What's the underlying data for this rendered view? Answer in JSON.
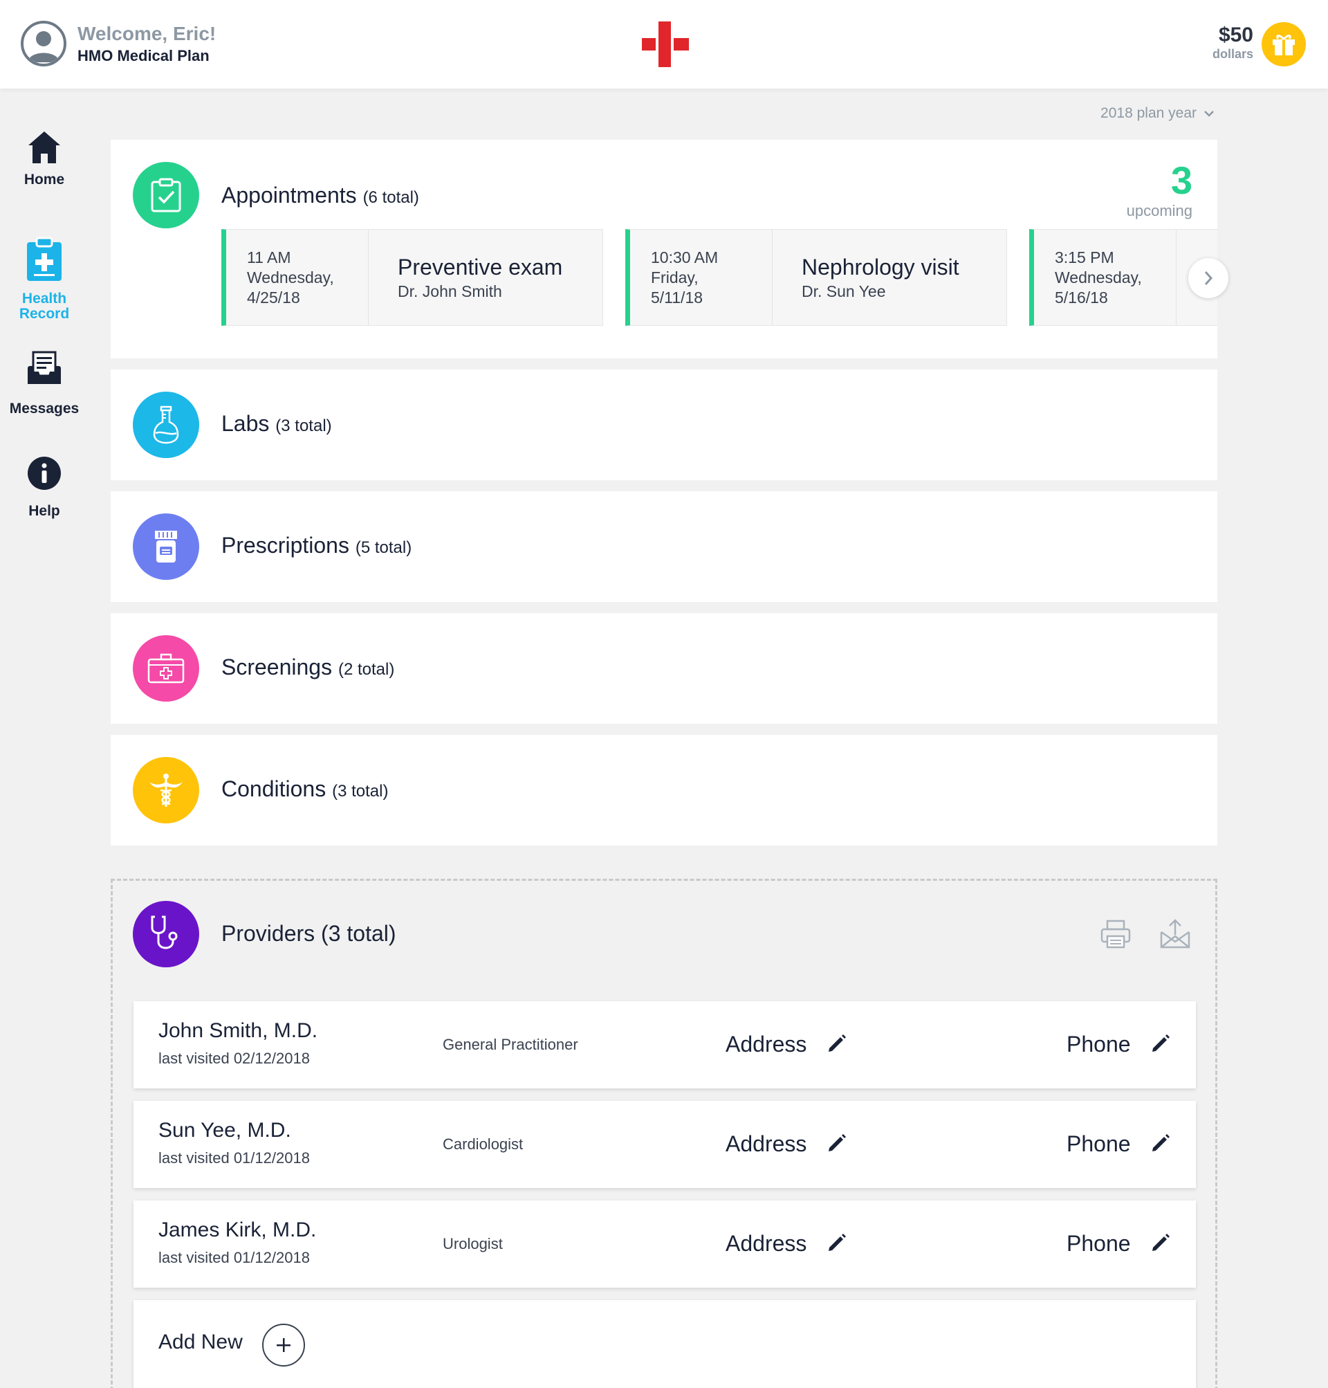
{
  "header": {
    "welcome": "Welcome, Eric!",
    "plan": "HMO Medical Plan",
    "credits_amount": "$50",
    "credits_unit": "dollars"
  },
  "sidebar": {
    "items": [
      {
        "label": "Home",
        "icon": "home-icon"
      },
      {
        "label_line1": "Health",
        "label_line2": "Record",
        "icon": "health-record-icon",
        "active": true
      },
      {
        "label": "Messages",
        "icon": "messages-icon"
      },
      {
        "label": "Help",
        "icon": "info-icon"
      }
    ]
  },
  "plan_year": "2018 plan year",
  "appointments": {
    "title": "Appointments",
    "total": "(6 total)",
    "upcoming_count": "3",
    "upcoming_label": "upcoming",
    "items": [
      {
        "time": "11 AM",
        "day": "Wednesday,",
        "date": "4/25/18",
        "name": "Preventive exam",
        "doctor": "Dr. John Smith"
      },
      {
        "time": "10:30 AM",
        "day": "Friday,",
        "date": "5/11/18",
        "name": "Nephrology visit",
        "doctor": "Dr. Sun Yee"
      },
      {
        "time": "3:15 PM",
        "day": "Wednesday,",
        "date": "5/16/18",
        "name": "",
        "doctor": ""
      }
    ]
  },
  "sections": [
    {
      "title": "Labs",
      "total": "(3 total)",
      "color": "#1cb8e8",
      "icon": "flask-icon"
    },
    {
      "title": "Prescriptions",
      "total": "(5 total)",
      "color": "#6d7ff0",
      "icon": "pill-bottle-icon"
    },
    {
      "title": "Screenings",
      "total": "(2 total)",
      "color": "#f54aa7",
      "icon": "medical-kit-icon"
    },
    {
      "title": "Conditions",
      "total": "(3 total)",
      "color": "#ffc30a",
      "icon": "caduceus-icon"
    }
  ],
  "providers": {
    "title": "Providers (3 total)",
    "color": "#6a14c9",
    "rows": [
      {
        "name": "John Smith, M.D.",
        "visited": "last visited 02/12/2018",
        "specialty": "General Practitioner",
        "address": "Address",
        "phone": "Phone"
      },
      {
        "name": "Sun Yee, M.D.",
        "visited": "last visited 01/12/2018",
        "specialty": "Cardiologist",
        "address": "Address",
        "phone": "Phone"
      },
      {
        "name": "James Kirk, M.D.",
        "visited": "last visited 01/12/2018",
        "specialty": "Urologist",
        "address": "Address",
        "phone": "Phone"
      }
    ],
    "add_new": "Add New"
  },
  "colors": {
    "accent_green": "#26d18e",
    "accent_blue": "#1cb3e8",
    "brand_red": "#e0262a",
    "gift_yellow": "#ffc30a"
  }
}
